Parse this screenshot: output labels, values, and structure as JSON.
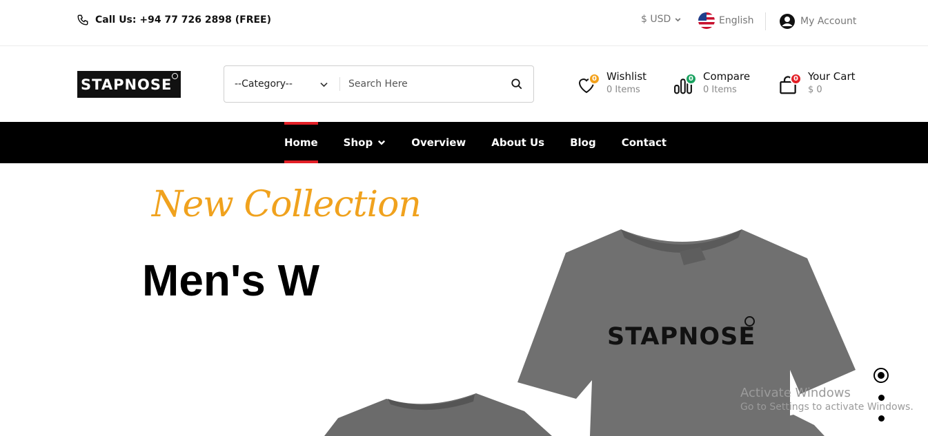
{
  "topbar": {
    "call": "Call Us: +94 77 726 2898 (FREE)",
    "currency": "$ USD",
    "language": "English",
    "account": "My Account"
  },
  "header": {
    "logo": "STAPNOSE",
    "category": "--Category--",
    "search_placeholder": "Search Here",
    "wishlist": {
      "label": "Wishlist",
      "sub": "0 Items",
      "count": "0",
      "badge_color": "#f3a11b"
    },
    "compare": {
      "label": "Compare",
      "sub": "0 Items",
      "count": "0",
      "badge_color": "#1aa260"
    },
    "cart": {
      "label": "Your Cart",
      "sub": "$ 0",
      "count": "0",
      "badge_color": "#e31f26"
    }
  },
  "nav": {
    "items": [
      "Home",
      "Shop",
      "Overview",
      "About Us",
      "Blog",
      "Contact"
    ],
    "active": "Home"
  },
  "hero": {
    "tagline": "New Collection",
    "headline": "Men's W",
    "shirt_brand": "STAPNOSE",
    "slides": 3,
    "active_slide": 1
  },
  "watermark": {
    "line1": "Activate Windows",
    "line2": "Go to Settings to activate Windows."
  },
  "colors": {
    "accent": "#e31f26",
    "tagline": "#f0a21e",
    "nav_bg": "#000000",
    "shirt": "#6e6e6e"
  }
}
